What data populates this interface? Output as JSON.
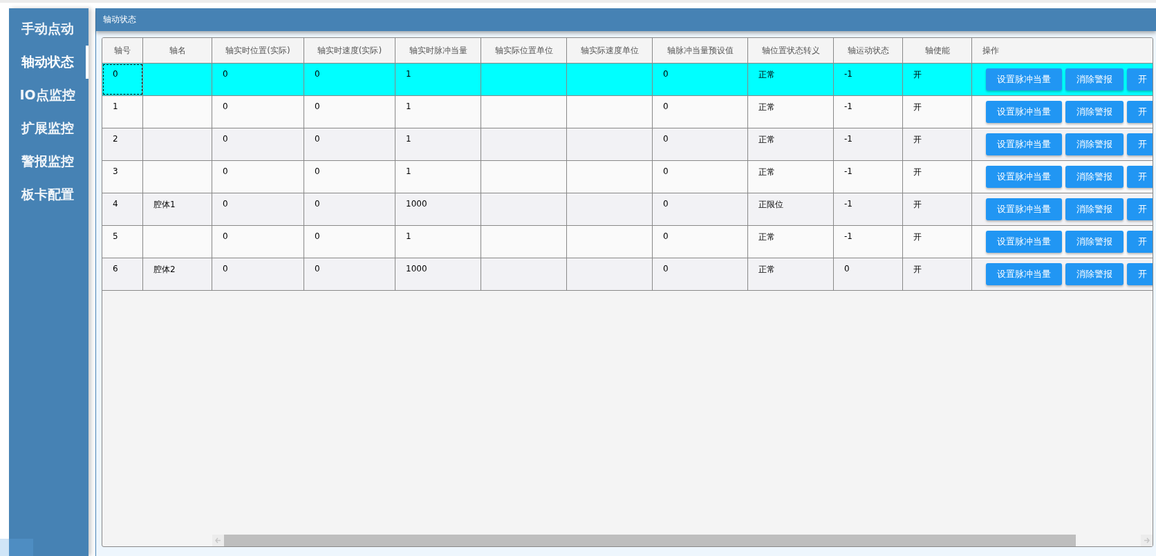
{
  "sidebar": {
    "items": [
      {
        "label": "手动点动",
        "selected": false
      },
      {
        "label": "轴动状态",
        "selected": true
      },
      {
        "label": "IO点监控",
        "selected": false
      },
      {
        "label": "扩展监控",
        "selected": false
      },
      {
        "label": "警报监控",
        "selected": false
      },
      {
        "label": "板卡配置",
        "selected": false
      }
    ]
  },
  "panel": {
    "title": "轴动状态"
  },
  "table": {
    "columns": [
      "轴号",
      "轴名",
      "轴实时位置(实际)",
      "轴实时速度(实际)",
      "轴实时脉冲当量",
      "轴实际位置单位",
      "轴实际速度单位",
      "轴脉冲当量预设值",
      "轴位置状态转义",
      "轴运动状态",
      "轴使能",
      "操作"
    ],
    "rows": [
      {
        "selected": true,
        "focused": true,
        "cells": [
          "0",
          "",
          "0",
          "0",
          "1",
          "",
          "",
          "0",
          "正常",
          "-1",
          "开"
        ],
        "actions": [
          "设置脉冲当量",
          "消除警报",
          "开"
        ]
      },
      {
        "selected": false,
        "focused": false,
        "cells": [
          "1",
          "",
          "0",
          "0",
          "1",
          "",
          "",
          "0",
          "正常",
          "-1",
          "开"
        ],
        "actions": [
          "设置脉冲当量",
          "消除警报",
          "开"
        ]
      },
      {
        "selected": false,
        "focused": false,
        "cells": [
          "2",
          "",
          "0",
          "0",
          "1",
          "",
          "",
          "0",
          "正常",
          "-1",
          "开"
        ],
        "actions": [
          "设置脉冲当量",
          "消除警报",
          "开"
        ]
      },
      {
        "selected": false,
        "focused": false,
        "cells": [
          "3",
          "",
          "0",
          "0",
          "1",
          "",
          "",
          "0",
          "正常",
          "-1",
          "开"
        ],
        "actions": [
          "设置脉冲当量",
          "消除警报",
          "开"
        ]
      },
      {
        "selected": false,
        "focused": false,
        "cells": [
          "4",
          "腔体1",
          "0",
          "0",
          "1000",
          "",
          "",
          "0",
          "正限位",
          "-1",
          "开"
        ],
        "actions": [
          "设置脉冲当量",
          "消除警报",
          "开"
        ]
      },
      {
        "selected": false,
        "focused": false,
        "cells": [
          "5",
          "",
          "0",
          "0",
          "1",
          "",
          "",
          "0",
          "正常",
          "-1",
          "开"
        ],
        "actions": [
          "设置脉冲当量",
          "消除警报",
          "开"
        ]
      },
      {
        "selected": false,
        "focused": false,
        "cells": [
          "6",
          "腔体2",
          "0",
          "0",
          "1000",
          "",
          "",
          "0",
          "正常",
          "0",
          "开"
        ],
        "actions": [
          "设置脉冲当量",
          "消除警报",
          "开"
        ]
      }
    ]
  }
}
